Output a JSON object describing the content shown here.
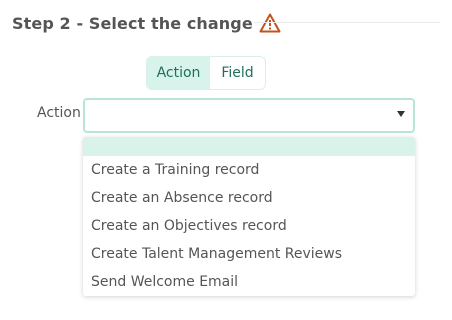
{
  "header": {
    "title": "Step 2 - Select the change",
    "warning_icon": "warning-triangle-icon",
    "warning_color": "#c0541a"
  },
  "mode_toggle": {
    "options": [
      "Action",
      "Field"
    ],
    "selected": "Action",
    "accent": "#d8f3eb"
  },
  "action_field": {
    "label": "Action",
    "value": "",
    "arrow_icon": "caret-down-icon"
  },
  "dropdown": {
    "options": [
      "",
      "Create a Training record",
      "Create an Absence record",
      "Create an Objectives record",
      "Create Talent Management Reviews",
      "Send Welcome Email"
    ],
    "highlighted_index": 0
  }
}
